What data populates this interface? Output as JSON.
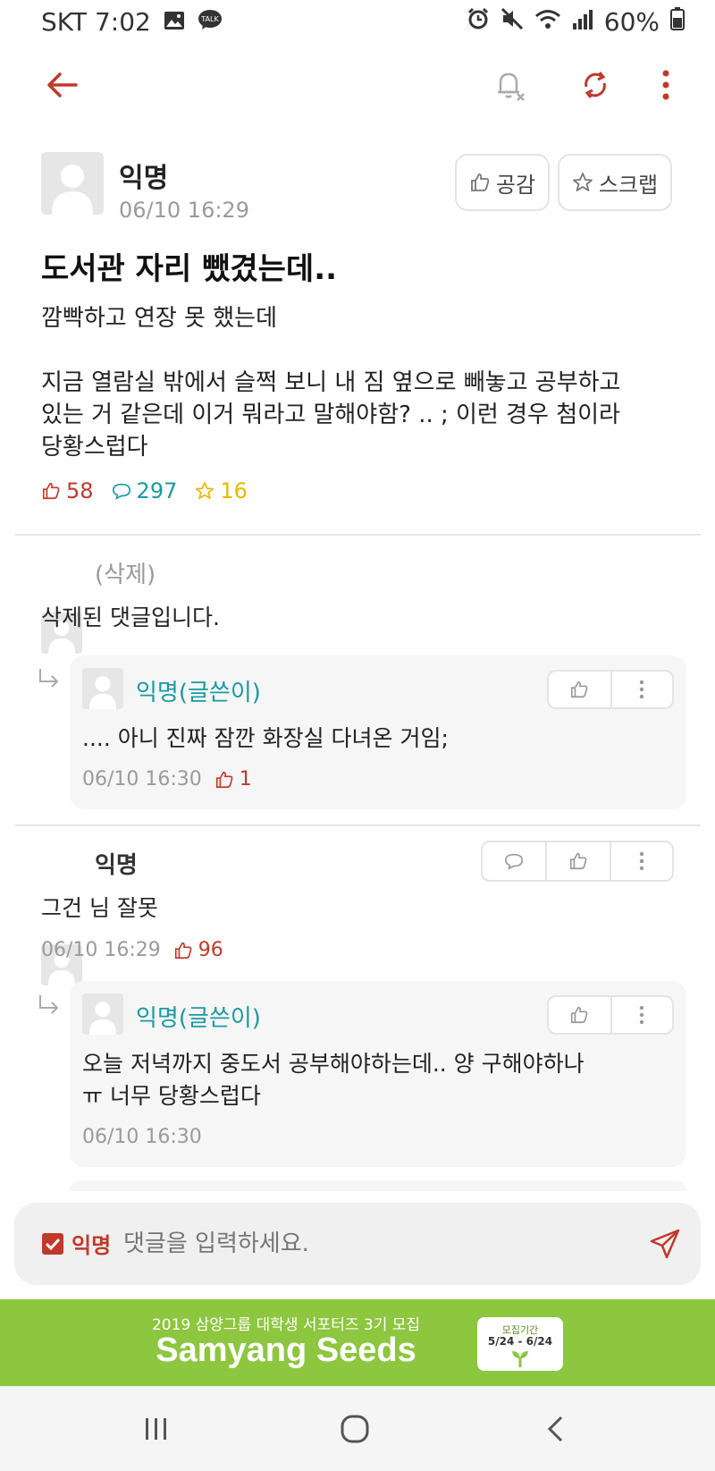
{
  "status": {
    "carrier_time": "SKT 7:02",
    "battery": "60%"
  },
  "post": {
    "author": "익명",
    "time": "06/10 16:29",
    "like_button": "공감",
    "scrap_button": "스크랩",
    "title": "도서관 자리 뺐겼는데..",
    "body_line1": "깜빡하고 연장 못 했는데",
    "body_line2": "지금 열람실 밖에서 슬쩍 보니 내 짐 옆으로 빼놓고 공부하고",
    "body_line3": "있는 거 같은데 이거 뭐라고 말해야함? .. ; 이런 경우 첨이라",
    "body_line4": "당황스럽다",
    "likes": "58",
    "comments": "297",
    "scraps": "16"
  },
  "comments": [
    {
      "author": "(삭제)",
      "text": "삭제된 댓글입니다.",
      "reply": {
        "author": "익명(글쓴이)",
        "text": ".... 아니 진짜 잠깐 화장실 다녀온 거임;",
        "time": "06/10 16:30",
        "likes": "1"
      }
    },
    {
      "author": "익명",
      "text": "그건 님 잘못",
      "time": "06/10 16:29",
      "likes": "96",
      "reply": {
        "author": "익명(글쓴이)",
        "text_line1": "오늘 저녁까지 중도서 공부해야하는데.. 양 구해야하나",
        "text_line2": "ㅠ 너무 당황스럽다",
        "time": "06/10 16:30"
      }
    }
  ],
  "input": {
    "anon_label": "익명",
    "placeholder": "댓글을 입력하세요."
  },
  "banner": {
    "subtitle": "2019 삼양그룹 대학생 서포터즈 3기 모집",
    "title": "Samyang Seeds",
    "badge_label": "모집기간",
    "badge_dates": "5/24 - 6/24"
  },
  "colors": {
    "accent_red": "#c0392b",
    "op_teal": "#1a9aa0",
    "scrap_yellow": "#e6b800",
    "banner_green": "#8dc63f"
  }
}
